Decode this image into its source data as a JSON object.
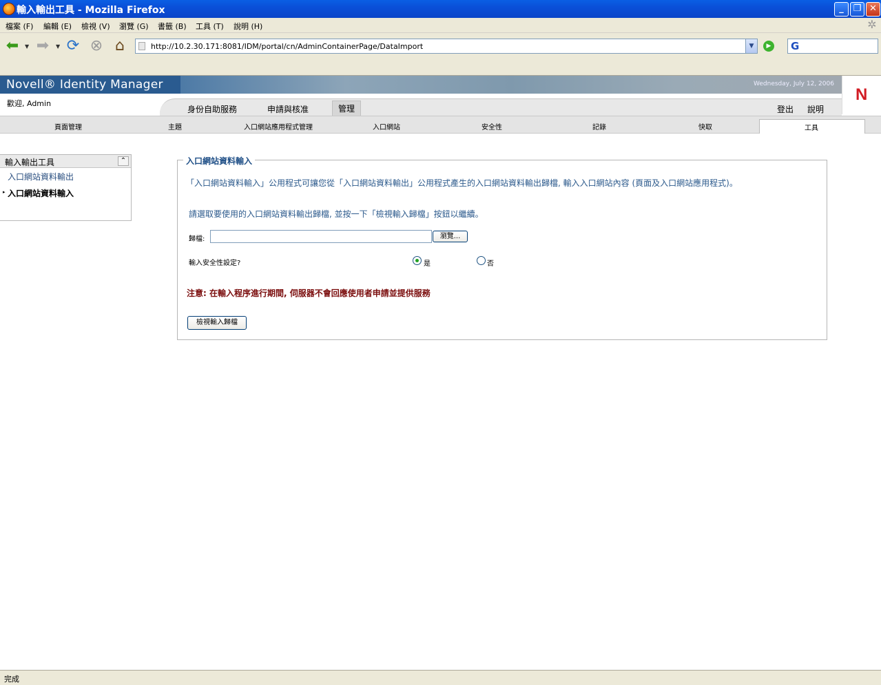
{
  "window": {
    "title": "輸入輸出工具 - Mozilla Firefox",
    "minimize": "_",
    "maximize": "❐",
    "close": "✕"
  },
  "menubar": [
    "檔案 (F)",
    "編輯 (E)",
    "檢視 (V)",
    "瀏覽 (G)",
    "書籤 (B)",
    "工具 (T)",
    "說明 (H)"
  ],
  "navbar": {
    "url": "http://10.2.30.171:8081/IDM/portal/cn/AdminContainerPage/DataImport",
    "search_engine_glyph": "G"
  },
  "header": {
    "brand": "Novell® Identity Manager",
    "date": "Wednesday, July 12, 2006",
    "logo_letter": "N",
    "welcome": "歡迎, Admin",
    "tabs": [
      "身份自助服務",
      "申請與核准",
      "管理"
    ],
    "active_tab": "管理",
    "right_links": [
      "登出",
      "說明"
    ]
  },
  "subtabs": [
    "頁面管理",
    "主題",
    "入口網站應用程式管理",
    "入口網站",
    "安全性",
    "記錄",
    "快取",
    "工具"
  ],
  "active_subtab": "工具",
  "sidebar": {
    "title": "輸入輸出工具",
    "items": [
      "入口網站資料輸出",
      "入口網站資料輸入"
    ],
    "selected": "入口網站資料輸入"
  },
  "main": {
    "legend": "入口網站資料輸入",
    "desc1": "「入口網站資料輸入」公用程式可讓您從「入口網站資料輸出」公用程式產生的入口網站資料輸出歸檔, 輸入入口網站內容 (頁面及入口網站應用程式)。",
    "desc2": "請選取要使用的入口網站資料輸出歸檔, 並按一下「檢視輸入歸檔」按鈕以繼續。",
    "file_label": "歸檔:",
    "file_value": "",
    "browse_label": "瀏覽...",
    "security_label": "輸入安全性設定?",
    "yes_label": "是",
    "no_label": "否",
    "security_selected": "是",
    "note": "注意: 在輸入程序進行期間, 伺服器不會回應使用者申請並提供服務",
    "view_button": "檢視輸入歸檔"
  },
  "status": "完成",
  "colors": {
    "brand_blue": "#2a5b90",
    "link_blue": "#2c5a8c",
    "note_red": "#7a0c0c",
    "novell_red": "#d21c24"
  }
}
